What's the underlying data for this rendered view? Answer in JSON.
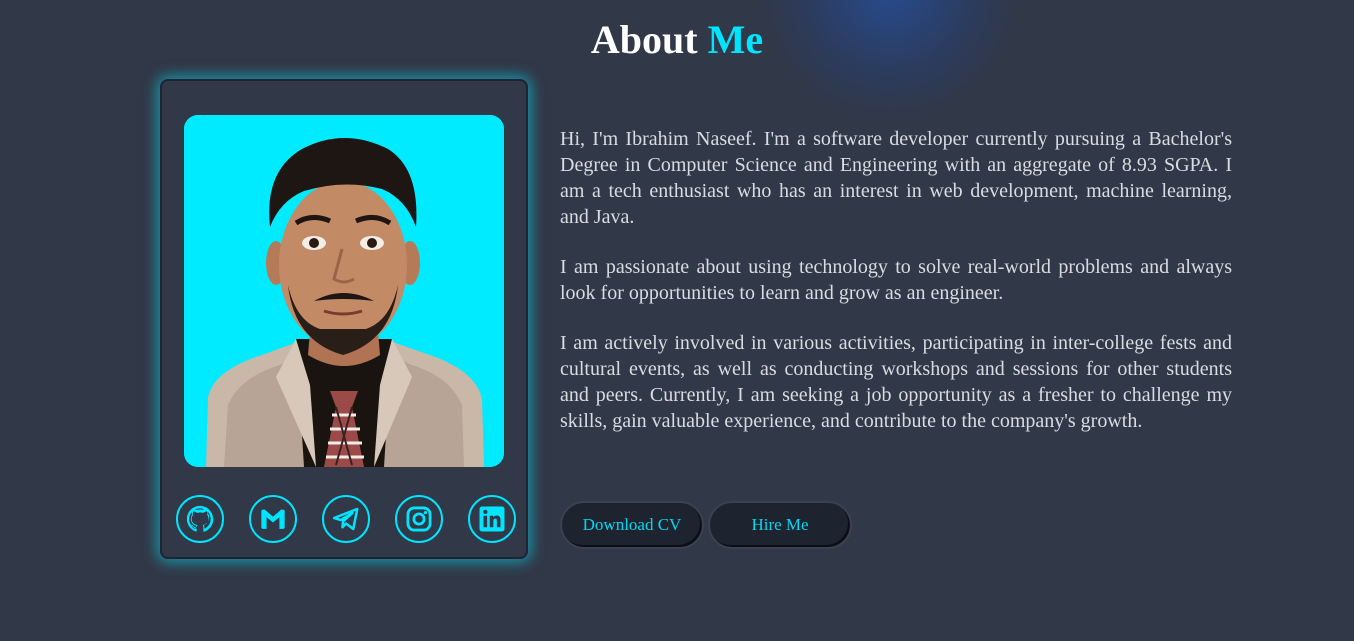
{
  "heading": {
    "part1": "About",
    "part2": "Me"
  },
  "colors": {
    "accent": "#00e5ff",
    "background": "#313847",
    "photo_bg": "#00ebff"
  },
  "profile": {
    "photo": "portrait-photo",
    "socials": [
      {
        "name": "GitHub",
        "icon": "github-icon"
      },
      {
        "name": "Gmail",
        "icon": "gmail-icon"
      },
      {
        "name": "Telegram",
        "icon": "telegram-icon"
      },
      {
        "name": "Instagram",
        "icon": "instagram-icon"
      },
      {
        "name": "LinkedIn",
        "icon": "linkedin-icon"
      }
    ]
  },
  "bio": {
    "paragraphs": [
      "Hi, I'm Ibrahim Naseef. I'm a software developer currently pursuing a Bachelor's Degree in Computer Science and Engineering with an aggregate of 8.93 SGPA. I am a tech enthusiast who has an interest in web development, machine learning, and Java.",
      "I am passionate about using technology to solve real-world problems and always look for opportunities to learn and grow as an engineer.",
      "I am actively involved in various activities, participating in inter-college fests and cultural events, as well as conducting workshops and sessions for other students and peers. Currently, I am seeking a job opportunity as a fresher to challenge my skills, gain valuable experience, and contribute to the company's growth."
    ]
  },
  "buttons": {
    "download_cv": "Download CV",
    "hire_me": "Hire Me"
  }
}
